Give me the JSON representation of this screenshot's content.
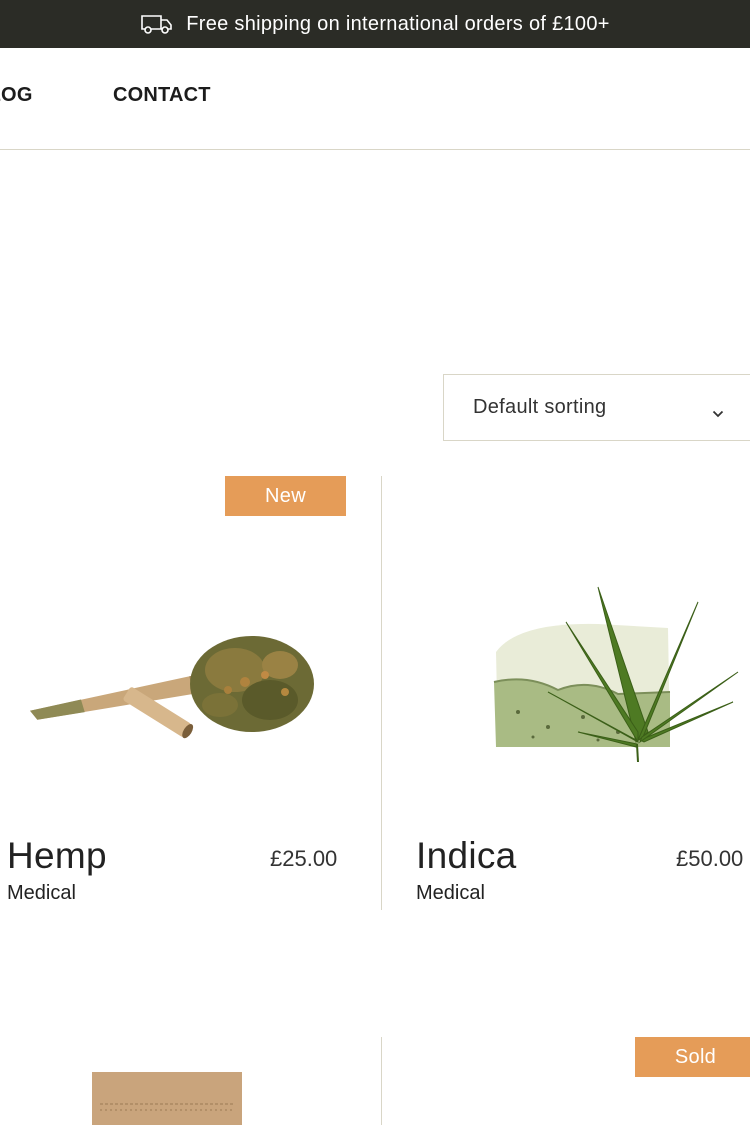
{
  "announcement": {
    "icon": "delivery-truck-icon",
    "text": "Free shipping on international orders of £100+"
  },
  "nav": {
    "items": [
      {
        "label": "BLOG"
      },
      {
        "label": "CONTACT"
      }
    ]
  },
  "sort": {
    "selected": "Default sorting",
    "icon": "chevron-down-icon"
  },
  "colors": {
    "topbar_bg": "#2b2c26",
    "badge": "#e59c58",
    "divider": "#d9d6c7"
  },
  "products": [
    {
      "name": "Hemp",
      "price": "£25.00",
      "category": "Medical",
      "badge": "New"
    },
    {
      "name": "Indica",
      "price": "£50.00",
      "category": "Medical",
      "badge": ""
    },
    {
      "name": "",
      "price": "",
      "category": "",
      "badge": ""
    },
    {
      "name": "",
      "price": "",
      "category": "",
      "badge": "Sold"
    }
  ]
}
